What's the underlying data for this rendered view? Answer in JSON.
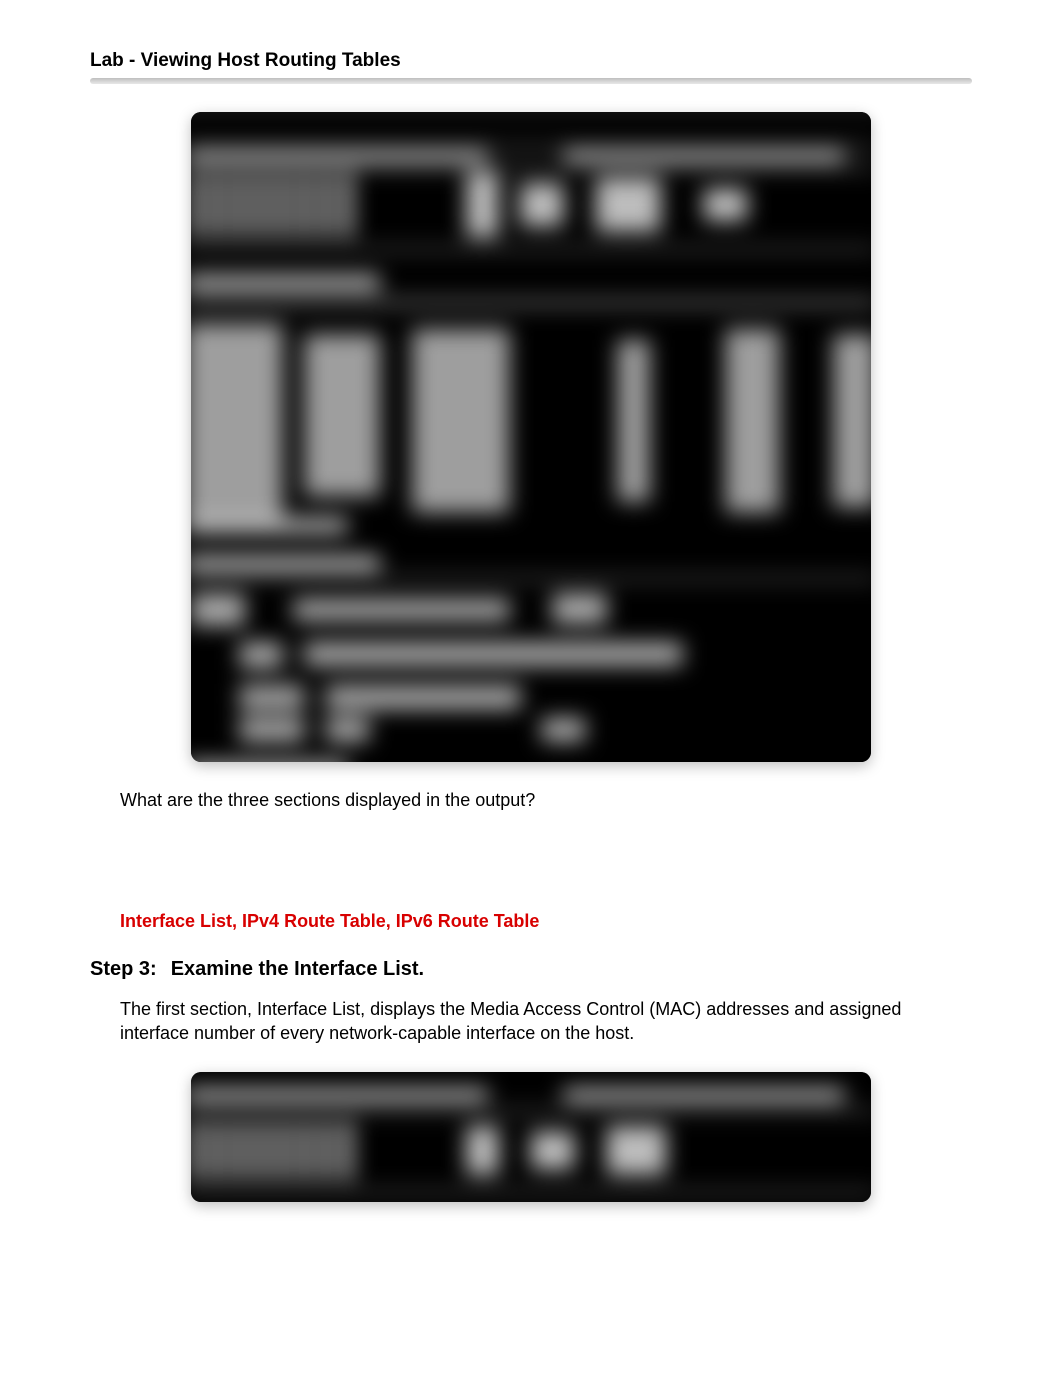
{
  "header": {
    "title": "Lab - Viewing Host Routing Tables"
  },
  "question": {
    "prompt": "What are the three sections displayed in the output?",
    "answer": "Interface List, IPv4 Route Table, IPv6 Route Table"
  },
  "step3": {
    "label_num": "Step 3:",
    "label_title": "Examine the Interface List.",
    "paragraph": "The first section, Interface List, displays the Media Access Control (MAC) addresses and assigned interface number of every network-capable interface on the host."
  }
}
